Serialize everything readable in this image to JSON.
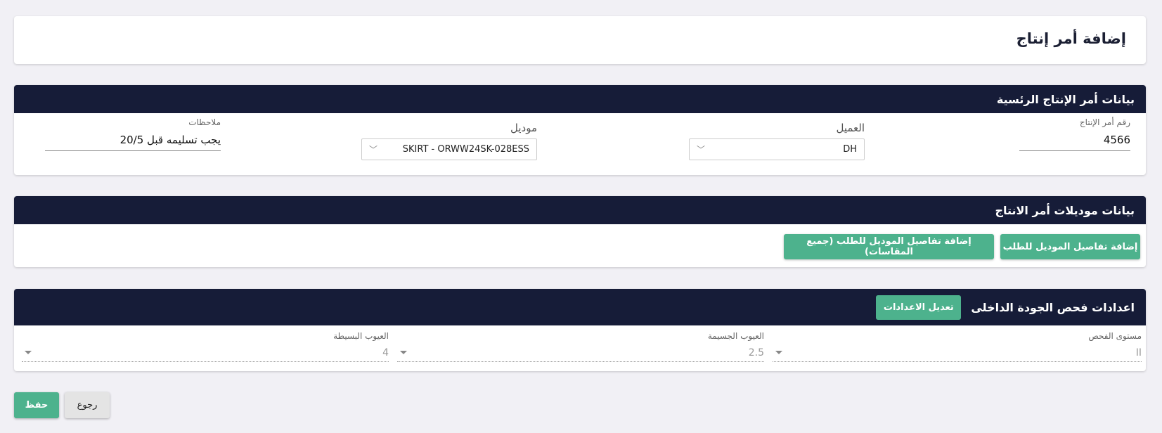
{
  "page": {
    "title": "إضافة أمر إنتاج"
  },
  "main_section": {
    "header": "بيانات أمر الإنتاج الرئسية",
    "order_number": {
      "label": "رقم أمر الإنتاج",
      "value": "4566"
    },
    "customer": {
      "label": "العميل",
      "value": "DH"
    },
    "model": {
      "label": "موديل",
      "value": "SKIRT - ORWW24SK-028ESS"
    },
    "notes": {
      "label": "ملاحظات",
      "value": "يجب تسليمه قبل 20/5"
    }
  },
  "models_section": {
    "header": "بيانات موديلات أمر الانتاج",
    "add_model_details_label": "إضافة تفاصيل الموديل للطلب",
    "add_model_details_all_sizes_label": "إضافة تفاصيل الموديل للطلب (جميع المقاسات)"
  },
  "qc_section": {
    "header": "اعدادات فحص الجودة الداخلى",
    "edit_settings_label": "تعديل الاعدادات",
    "inspection_level": {
      "label": "مستوى الفحص",
      "value": "II"
    },
    "major_defects": {
      "label": "العيوب الجسيمة",
      "value": "2.5"
    },
    "minor_defects": {
      "label": "العيوب البسيطة",
      "value": "4"
    }
  },
  "footer": {
    "save_label": "حفظ",
    "back_label": "رجوع"
  },
  "colors": {
    "header_bg": "#161c38",
    "accent_green": "#4db28d",
    "page_bg": "#f1f0f5"
  }
}
